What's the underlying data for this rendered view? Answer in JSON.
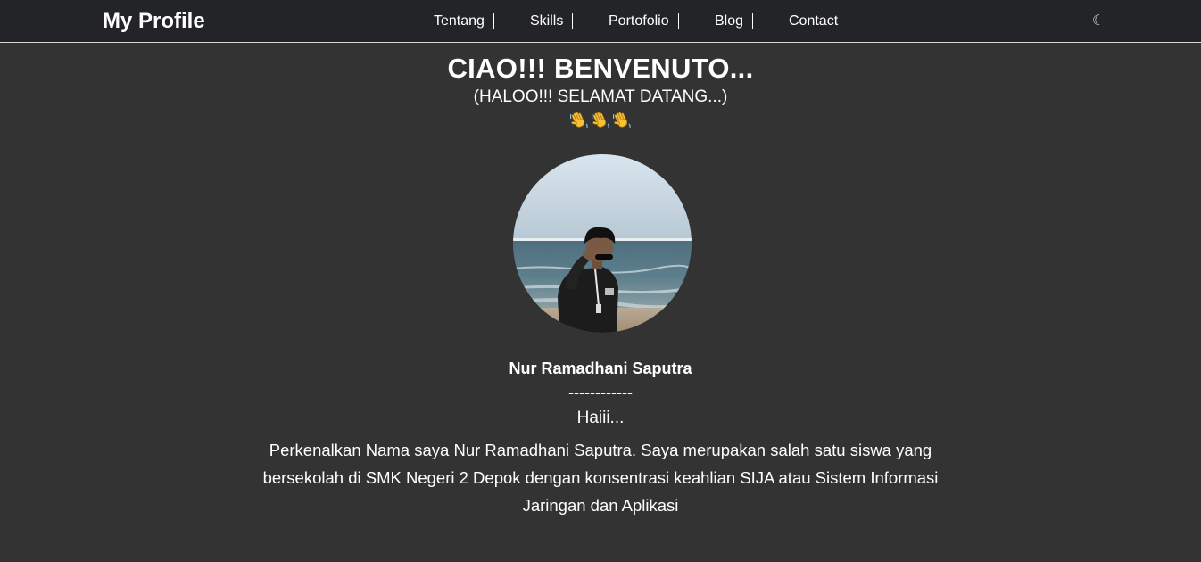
{
  "navbar": {
    "brand": "My Profile",
    "links": [
      {
        "label": "Tentang"
      },
      {
        "label": "Skills"
      },
      {
        "label": "Portofolio"
      },
      {
        "label": "Blog"
      },
      {
        "label": "Contact"
      }
    ],
    "theme_toggle": {
      "icon": "moon-icon",
      "glyph": "☾"
    }
  },
  "hero": {
    "title": "CIAO!!! BENVENUTO...",
    "subtitle": "(HALOO!!! SELAMAT DATANG...)",
    "wave_icons": [
      "waving-hand-icon",
      "waving-hand-icon",
      "waving-hand-icon"
    ]
  },
  "profile": {
    "photo": "profile-photo",
    "name": "Nur Ramadhani Saputra",
    "divider": "------------",
    "greeting": "Haiii...",
    "intro": "Perkenalkan Nama saya Nur Ramadhani Saputra. Saya merupakan salah satu siswa yang bersekolah di SMK Negeri 2 Depok dengan konsentrasi keahlian SIJA atau Sistem Informasi Jaringan dan Aplikasi"
  },
  "colors": {
    "page_background": "#333333",
    "navbar_background": "#232427",
    "text": "#ffffff"
  }
}
